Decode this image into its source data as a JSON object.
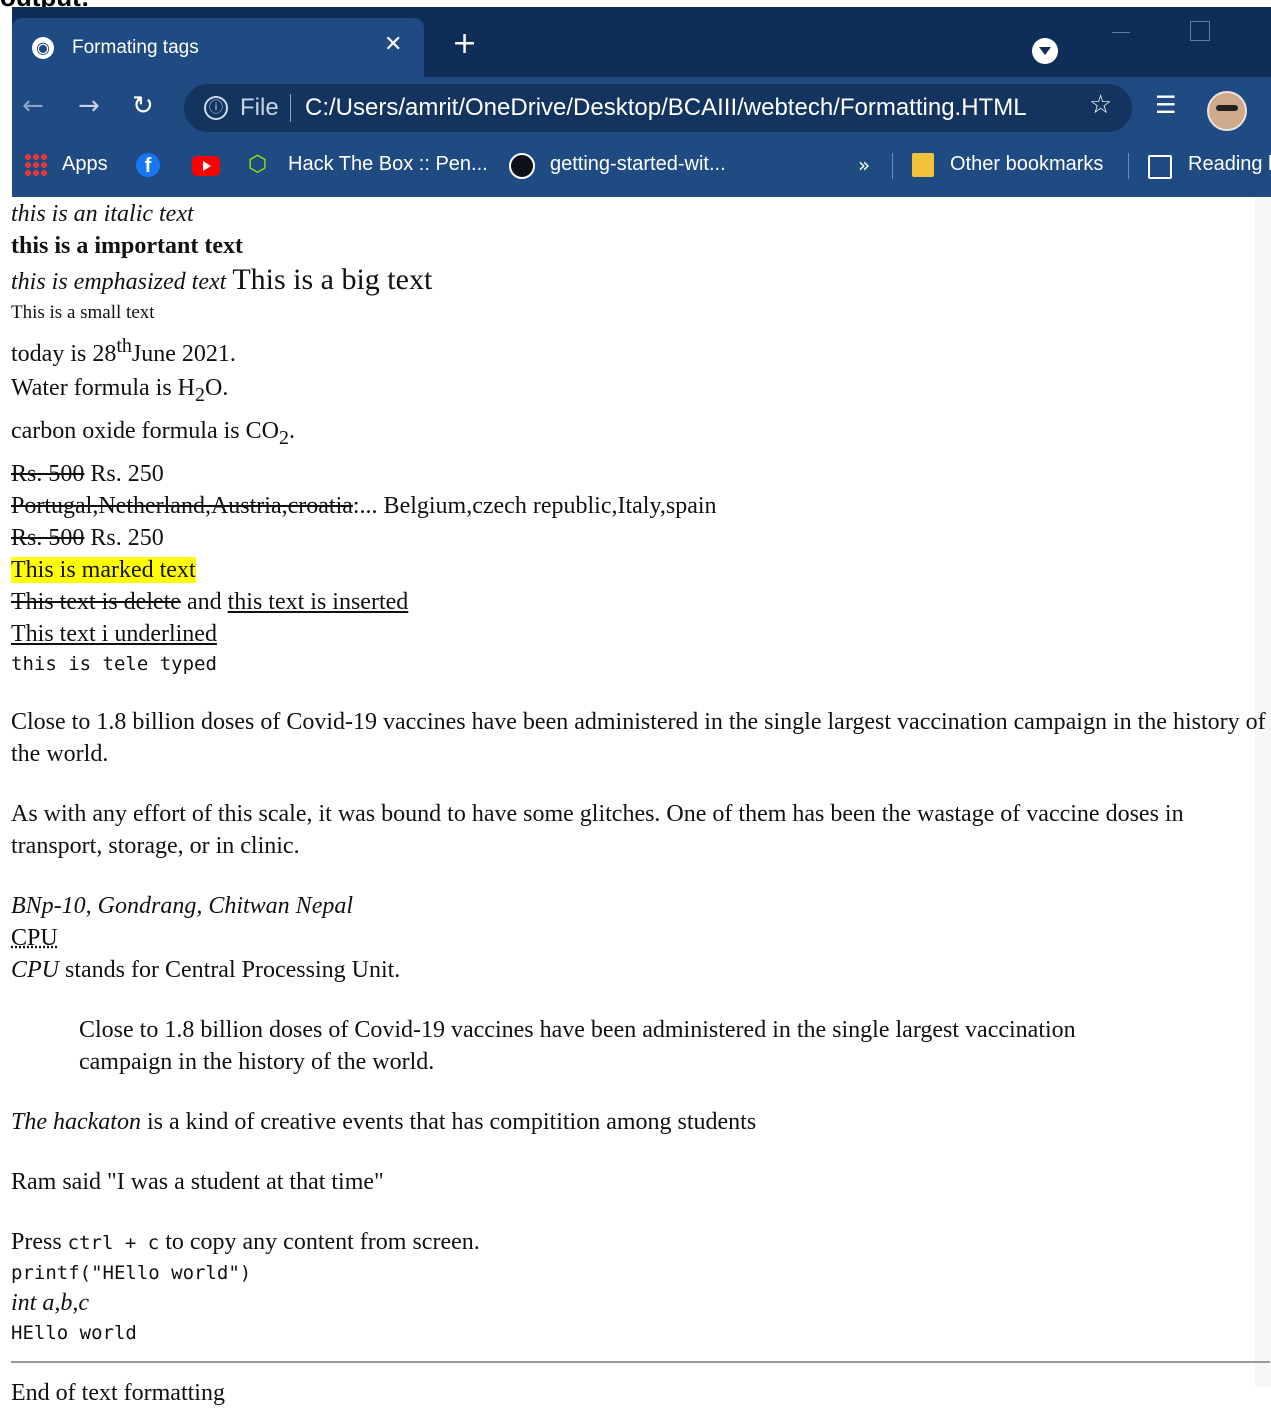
{
  "caption": "output:",
  "browser": {
    "tab_title": "Formating tags",
    "tab_close": "✕",
    "new_tab": "+",
    "omnibox_info": "ⓘ",
    "omnibox_scheme": "File",
    "url": "C:/Users/amrit/OneDrive/Desktop/BCAIII/webtech/Formatting.HTML",
    "bookmarks": {
      "apps": "Apps",
      "hackthebox": "Hack The Box :: Pen...",
      "github": "getting-started-wit...",
      "more": "»",
      "other": "Other bookmarks",
      "reading": "Reading l"
    },
    "icons": [
      "chrome-globe-icon",
      "close-icon",
      "plus-icon",
      "profile-dropdown-icon",
      "back-icon",
      "forward-icon",
      "reload-icon",
      "info-icon",
      "star-icon",
      "media-icon",
      "avatar",
      "apps-icon",
      "facebook-icon",
      "youtube-icon",
      "hackthebox-icon",
      "github-icon",
      "folder-icon",
      "reading-list-icon"
    ]
  },
  "page": {
    "italic": "this is an italic text",
    "strong": "this is a important text",
    "em": "this is emphasized text",
    "big": "This is a big text",
    "small": "This is a small text",
    "date_pre": "today is 28",
    "date_sup": "th",
    "date_post": "June 2021.",
    "water_pre": "Water formula is H",
    "water_sub": "2",
    "water_post": "O.",
    "co2_pre": "carbon oxide formula is CO",
    "co2_sub": "2",
    "co2_post": ".",
    "price_old": "Rs. 500",
    "price_new": " Rs. 250",
    "countries_old": "Portugal,Netherland,Austria,croatia",
    "countries_new": ":... Belgium,czech republic,Italy,spain",
    "price_old2": "Rs. 500",
    "price_new2": " Rs. 250",
    "marked": "This is marked text",
    "deleted": "This text is delete",
    "and": " and ",
    "inserted": "this text is inserted",
    "underlined": "This text i underlined",
    "teletype": "this is tele typed",
    "para1": "Close to 1.8 billion doses of Covid-19 vaccines have been administered in the single largest vaccination campaign in the history of the world.",
    "para2": "As with any effort of this scale, it was bound to have some glitches. One of them has been the wastage of vaccine doses in transport, storage, or in clinic.",
    "address": "BNp-10, Gondrang, Chitwan Nepal",
    "abbr": "CPU",
    "dfn": "CPU",
    "dfn_rest": " stands for Central Processing Unit.",
    "blockquote": "Close to 1.8 billion doses of Covid-19 vaccines have been administered in the single largest vaccination campaign in the history of the world.",
    "cite": "The hackaton",
    "cite_rest": " is a kind of creative events that has compitition among students",
    "quote": "Ram said \"I was a student at that time\"",
    "kbd_pre": "Press ",
    "kbd": "ctrl + c",
    "kbd_post": " to copy any content from screen.",
    "code": "printf(\"HEllo world\")",
    "var": "int a,b,c",
    "samp": "HEllo world",
    "footer": "End of text formatting"
  }
}
